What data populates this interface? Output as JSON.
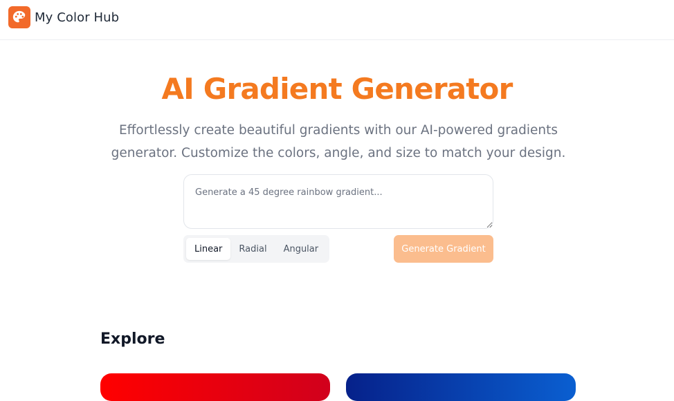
{
  "header": {
    "brand_name": "My Color Hub",
    "logo_icon": "palette-icon",
    "logo_color": "#f26a2a"
  },
  "hero": {
    "title": "AI Gradient Generator",
    "subtitle": "Effortlessly create beautiful gradients with our AI-powered gradients generator. Customize the colors, angle, and size to match your design.",
    "title_color": "#f47a20"
  },
  "generator": {
    "prompt_placeholder": "Generate a 45 degree rainbow gradient...",
    "prompt_value": "",
    "types": [
      "Linear",
      "Radial",
      "Angular"
    ],
    "selected_type": "Linear",
    "generate_label": "Generate Gradient",
    "generate_color": "#fbbd8e"
  },
  "explore": {
    "heading": "Explore",
    "cards": [
      {
        "colors": [
          "#ff0000",
          "#d1001c"
        ]
      },
      {
        "colors": [
          "#06218a",
          "#0a5fd1"
        ]
      }
    ]
  }
}
